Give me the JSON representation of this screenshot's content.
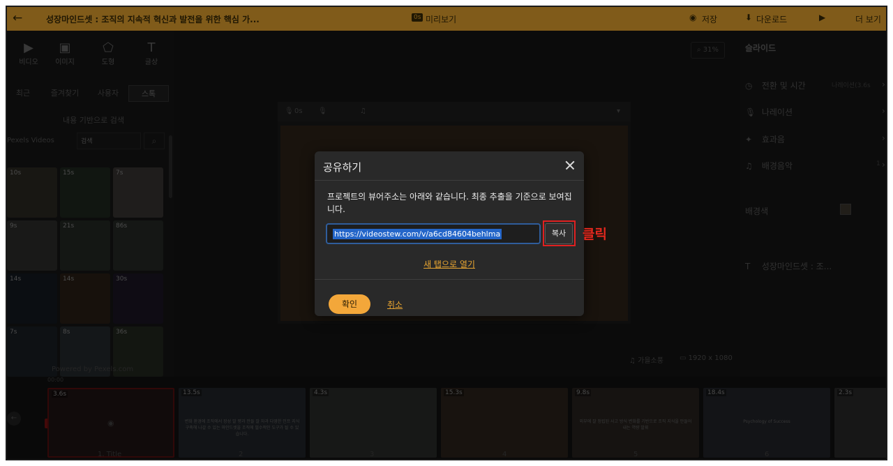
{
  "topbar": {
    "title": "성장마인드셋 : 조직의 지속적 혁신과 발전을 위한 핵심 가...",
    "time_badge": "0s",
    "preview": "미리보기",
    "save": "저장",
    "download": "다운로드",
    "more": "더 보기"
  },
  "leftpanel": {
    "tools": [
      {
        "label": "비디오",
        "icon": "video-icon",
        "glyph": "▶"
      },
      {
        "label": "이미지",
        "icon": "image-icon",
        "glyph": "▣"
      },
      {
        "label": "도형",
        "icon": "shape-icon",
        "glyph": "⬠"
      },
      {
        "label": "글상",
        "icon": "text-icon",
        "glyph": "T"
      }
    ],
    "subtabs": [
      "최근",
      "즐겨찾기",
      "사용자",
      "스톡"
    ],
    "content_search": "내용 기반으로 검색",
    "source": "Pexels Videos",
    "search_placeholder": "검색",
    "thumb_durations": [
      "10s",
      "15s",
      "7s",
      "9s",
      "21s",
      "86s",
      "14s",
      "14s",
      "30s",
      "7s",
      "8s",
      "36s"
    ],
    "powered": "Powered by Pexels.com"
  },
  "canvas": {
    "zoom": "31%",
    "pv_time": "0s",
    "audio": "가을소풍",
    "resolution": "1920 x 1080"
  },
  "rightpanel": {
    "title": "슬라이드",
    "rows": [
      {
        "icon": "clock-icon",
        "glyph": "◷",
        "label": "전환 및 시간",
        "value": "나레이션(3.6s"
      },
      {
        "icon": "mic-icon",
        "glyph": "🎙",
        "label": "나레이션",
        "value": ""
      },
      {
        "icon": "effect-icon",
        "glyph": "✦",
        "label": "효과음",
        "value": ""
      },
      {
        "icon": "music-icon",
        "glyph": "♫",
        "label": "배경음악",
        "value": "1"
      }
    ],
    "bg_label": "배경색",
    "layer_label": "성장마인드셋 : 조..."
  },
  "timeline": {
    "time": "00:00",
    "clips": [
      {
        "dur": "3.6s",
        "num": "1. Title"
      },
      {
        "dur": "13.5s",
        "num": "2"
      },
      {
        "dur": "4.3s",
        "num": "3"
      },
      {
        "dur": "15.3s",
        "num": "4"
      },
      {
        "dur": "9.8s",
        "num": "5"
      },
      {
        "dur": "18.4s",
        "num": "6"
      },
      {
        "dur": "2.3s",
        "num": ""
      }
    ],
    "captions": [
      "",
      "변화 환경에 조직에서 장성 발 평과 만들 잘 자과 다영한 인프 지식 구축해 나갈 수 있는 마인드셋을 조직에 필수적인 도구가 될 수 있습니다.",
      "",
      "",
      "외부에 잘 정립된 사고 방식 변화를 기반으로 조직 지식을 만들어내는 역량 발휘",
      "Psychology of Success",
      ""
    ]
  },
  "modal": {
    "title": "공유하기",
    "description": "프로젝트의 뷰어주소는 아래와 같습니다. 최종 추출을 기준으로 보여집니다.",
    "url": "https://videostew.com/v/a6cd84604behlma",
    "copy": "복사",
    "new_tab": "새 탭으로 열기",
    "confirm": "확인",
    "cancel": "취소"
  },
  "annotation": {
    "click": "클릭",
    "color": "#e02020"
  }
}
